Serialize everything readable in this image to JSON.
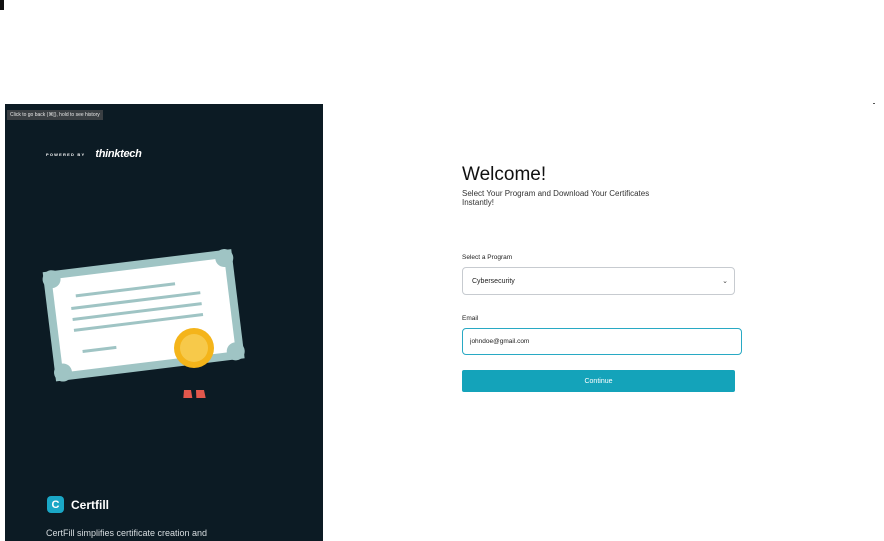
{
  "tooltip": "Click to go back (⌘[), hold to see history",
  "left_panel": {
    "powered_by": "POWERED BY",
    "brand": "thinktech",
    "app_name": "Certfill",
    "logo_letter": "C",
    "tagline": "CertFill simplifies certificate creation and"
  },
  "form": {
    "title": "Welcome!",
    "subtitle": "Select Your Program and Download Your Certificates Instantly!",
    "program_label": "Select a Program",
    "program_value": "Cybersecurity",
    "email_label": "Email",
    "email_value": "johndoe@gmail.com",
    "continue_label": "Continue"
  },
  "icons": {
    "chevron": "chevron-down-icon",
    "certificate": "certificate-illustration-icon",
    "logo": "certfill-logo-icon"
  },
  "colors": {
    "panel_bg": "#0c1b24",
    "accent": "#14a3ba",
    "certificate_frame": "#9fc4c4",
    "medal": "#f4b41a",
    "ribbon": "#e2574c"
  }
}
